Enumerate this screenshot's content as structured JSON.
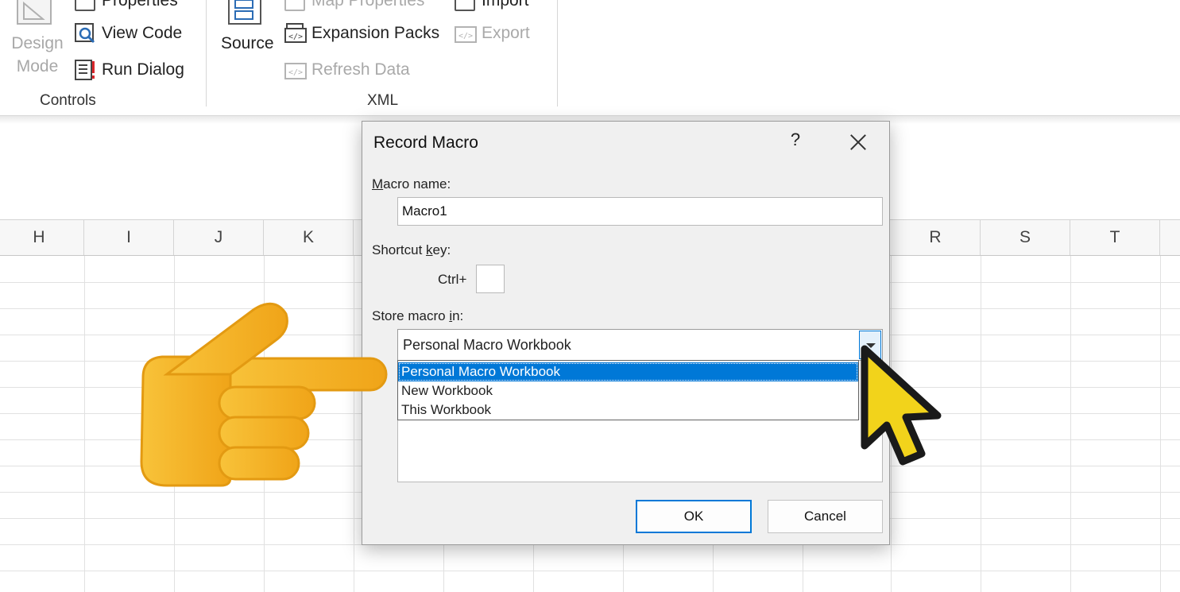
{
  "ribbon": {
    "design_mode_line1": "Design",
    "design_mode_line2": "Mode",
    "properties": "Properties",
    "view_code": "View Code",
    "run_dialog": "Run Dialog",
    "controls_group": "Controls",
    "source": "Source",
    "map_properties": "Map Properties",
    "expansion_packs": "Expansion Packs",
    "refresh_data": "Refresh Data",
    "import": "Import",
    "export": "Export",
    "xml_group": "XML"
  },
  "sheet": {
    "columns": [
      {
        "label": "H"
      },
      {
        "label": "I"
      },
      {
        "label": "J"
      },
      {
        "label": "K"
      },
      {
        "label": "R"
      },
      {
        "label": "S"
      },
      {
        "label": "T"
      }
    ]
  },
  "dialog": {
    "title": "Record Macro",
    "help": "?",
    "macro_name_label_u": "M",
    "macro_name_label_rest": "acro name:",
    "macro_name_value": "Macro1",
    "shortcut_label_pre": "Shortcut ",
    "shortcut_label_u": "k",
    "shortcut_label_post": "ey:",
    "ctrl_label": "Ctrl+",
    "shortcut_value": "",
    "store_label_pre": "Store macro ",
    "store_label_u": "i",
    "store_label_post": "n:",
    "store_selected": "Personal Macro Workbook",
    "store_options": [
      {
        "label": "Personal Macro Workbook",
        "selected": true
      },
      {
        "label": "New Workbook",
        "selected": false
      },
      {
        "label": "This Workbook",
        "selected": false
      }
    ],
    "ok": "OK",
    "cancel": "Cancel"
  },
  "colors": {
    "accent": "#0078d7",
    "hand": "#f7b52c",
    "cursor": "#f2d31b"
  },
  "overlays": {
    "pointing_hand": "backhand-index-pointing-right-emoji",
    "cursor": "yellow-arrow-cursor"
  }
}
